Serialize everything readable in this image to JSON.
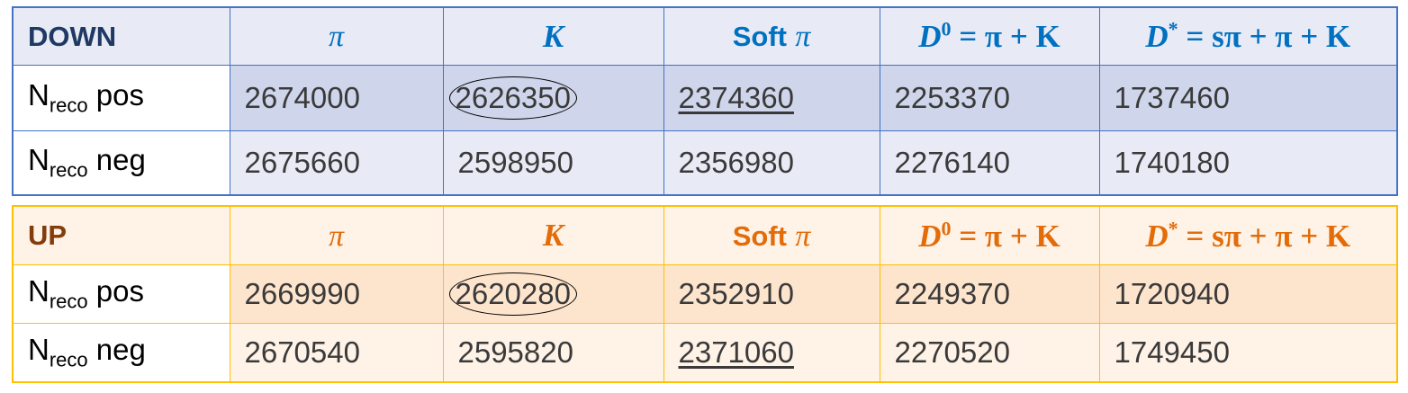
{
  "down": {
    "title": "DOWN",
    "headers": {
      "pi": "π",
      "k": "K",
      "soft_prefix": "Soft",
      "soft_sym": "π",
      "d0": {
        "sym": "D",
        "sup": "0",
        "rest": " = π + K"
      },
      "dstar": {
        "sym": "D",
        "sup": "*",
        "rest": " = sπ + π + K"
      }
    },
    "rows": [
      {
        "label_main": "N",
        "label_sub": "reco",
        "label_suffix": " pos",
        "values": [
          "2674000",
          "2626350",
          "2374360",
          "2253370",
          "1737460"
        ]
      },
      {
        "label_main": "N",
        "label_sub": "reco",
        "label_suffix": " neg",
        "values": [
          "2675660",
          "2598950",
          "2356980",
          "2276140",
          "1740180"
        ]
      }
    ]
  },
  "up": {
    "title": "UP",
    "headers": {
      "pi": "π",
      "k": "K",
      "soft_prefix": "Soft",
      "soft_sym": "π",
      "d0": {
        "sym": "D",
        "sup": "0",
        "rest": " = π + K"
      },
      "dstar": {
        "sym": "D",
        "sup": "*",
        "rest": " = sπ + π + K"
      }
    },
    "rows": [
      {
        "label_main": "N",
        "label_sub": "reco",
        "label_suffix": " pos",
        "values": [
          "2669990",
          "2620280",
          "2352910",
          "2249370",
          "1720940"
        ]
      },
      {
        "label_main": "N",
        "label_sub": "reco",
        "label_suffix": " neg",
        "values": [
          "2670540",
          "2595820",
          "2371060",
          "2270520",
          "1749450"
        ]
      }
    ]
  },
  "colors": {
    "down_border": "#4472c4",
    "down_header_text": "#0070c0",
    "down_title": "#1f3864",
    "up_border": "#ffc000",
    "up_header_text": "#e36c09",
    "up_title": "#833c0b"
  }
}
